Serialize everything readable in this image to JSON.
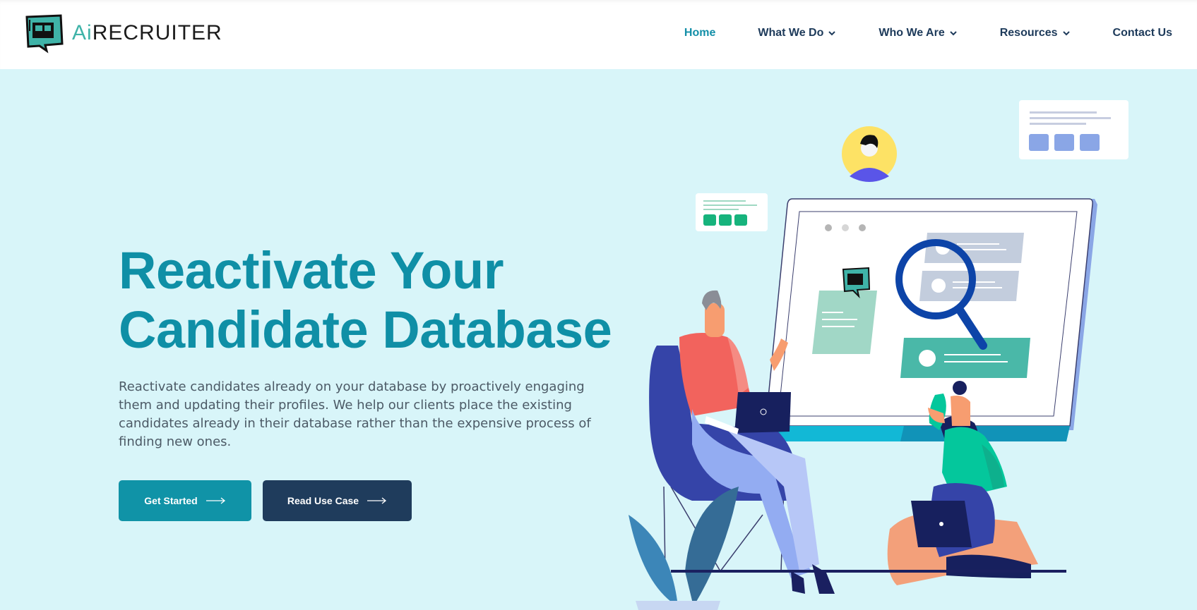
{
  "brand": {
    "name_prefix": "Ai",
    "name_suffix": "RECRUITER"
  },
  "nav": {
    "items": [
      {
        "label": "Home",
        "active": true,
        "has_dropdown": false
      },
      {
        "label": "What We Do",
        "active": false,
        "has_dropdown": true
      },
      {
        "label": "Who We Are",
        "active": false,
        "has_dropdown": true
      },
      {
        "label": "Resources",
        "active": false,
        "has_dropdown": true
      },
      {
        "label": "Contact Us",
        "active": false,
        "has_dropdown": false
      }
    ]
  },
  "hero": {
    "title_line1": "Reactivate Your",
    "title_line2": "Candidate Database",
    "description": "Reactivate candidates already on your database by proactively engaging them and updating their profiles. We help our clients place the existing candidates already in their database rather than the expensive process of finding new ones.",
    "primary_button": "Get Started",
    "secondary_button": "Read Use Case"
  },
  "colors": {
    "accent": "#0f8fa6",
    "nav_text": "#1d3a5a",
    "background": "#d8f5f9",
    "secondary_button": "#1f3c5c"
  }
}
